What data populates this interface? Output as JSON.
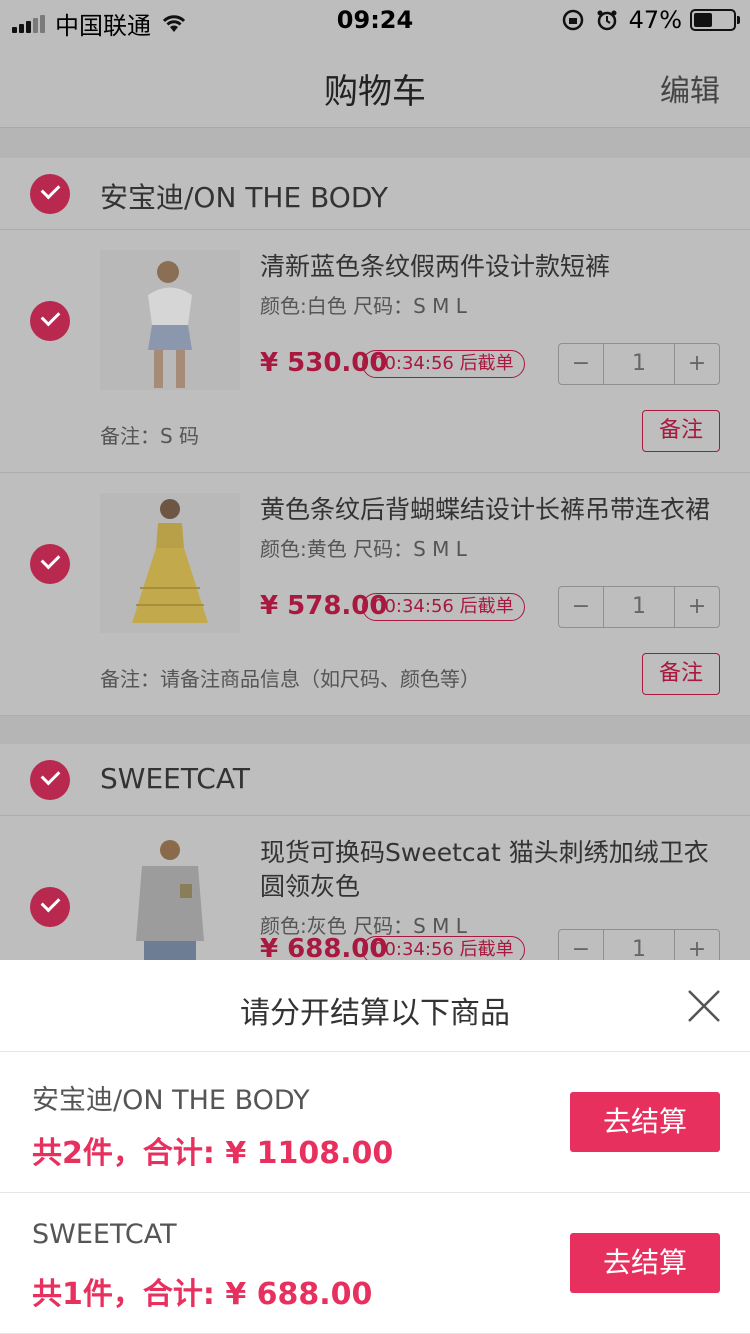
{
  "status_bar": {
    "carrier": "中国联通",
    "time": "09:24",
    "battery": "47%",
    "battery_level": 0.47
  },
  "nav": {
    "title": "购物车",
    "edit_label": "编辑"
  },
  "shops": [
    {
      "name": "安宝迪/ON THE BODY",
      "items": [
        {
          "title": "清新蓝色条纹假两件设计款短裤",
          "attrs": "颜色:白色  尺码：S M L",
          "price": "¥ 530.00",
          "deadline": "00:34:56 后截单",
          "qty": "1",
          "note": "备注：S 码",
          "note_btn": "备注"
        },
        {
          "title": "黄色条纹后背蝴蝶结设计长裤吊带连衣裙",
          "attrs": "颜色:黄色  尺码：S M L",
          "price": "¥ 578.00",
          "deadline": "00:34:56 后截单",
          "qty": "1",
          "note": "备注：请备注商品信息（如尺码、颜色等）",
          "note_btn": "备注"
        }
      ]
    },
    {
      "name": "SWEETCAT",
      "items": [
        {
          "title": "现货可换码Sweetcat 猫头刺绣加绒卫衣圆领灰色",
          "attrs": "颜色:灰色  尺码：S M L",
          "price": "¥ 688.00",
          "deadline": "00:34:56 后截单",
          "qty": "1"
        }
      ]
    }
  ],
  "stepper": {
    "minus": "−",
    "plus": "+"
  },
  "sheet": {
    "title": "请分开结算以下商品",
    "rows": [
      {
        "shop": "安宝迪/ON THE BODY",
        "total": "共2件，合计: ¥ 1108.00",
        "button": "去结算"
      },
      {
        "shop": "SWEETCAT",
        "total": "共1件，合计: ¥ 688.00",
        "button": "去结算"
      }
    ]
  },
  "colors": {
    "accent": "#e8305f",
    "dim_accent": "#a8183f",
    "overlay_bg": "#bdbdbd"
  }
}
